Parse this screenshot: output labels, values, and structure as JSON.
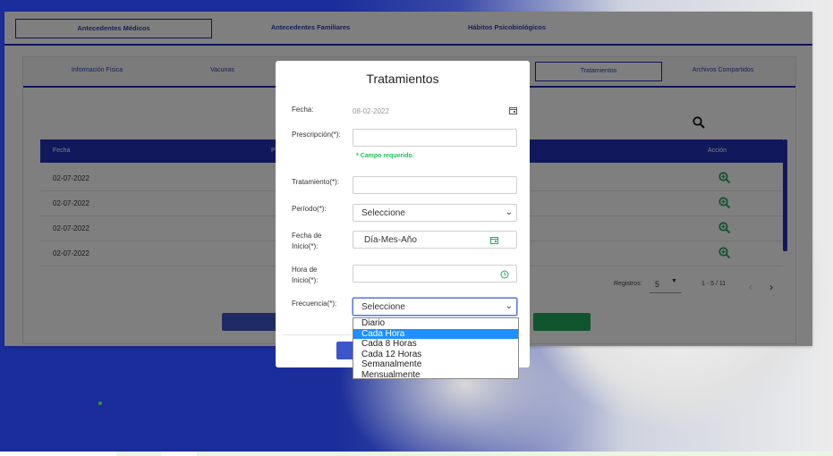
{
  "top_tabs": [
    "Antecedentes Médicos",
    "Antecedentes Familiares",
    "Hábitos Psicobiológicos"
  ],
  "sub_tabs": [
    "Información Física",
    "Vacunas",
    "Tratamientos",
    "Archivos Compartidos"
  ],
  "table": {
    "headers": [
      "Fecha",
      "P",
      "Acción"
    ],
    "rows": [
      "02-07-2022",
      "02-07-2022",
      "02-07-2022",
      "02-07-2022"
    ]
  },
  "footer": {
    "registros_label": "Registros:",
    "registros_value": "5",
    "range": "1 - 5 / 11"
  },
  "modal": {
    "title": "Tratamientos",
    "fecha_label": "Fecha:",
    "fecha_value": "08-02-2022",
    "prescripcion_label": "Prescripción(*):",
    "required_msg": "* Campo requerido.",
    "tratamiento_label": "Tratamiento(*):",
    "periodo_label": "Período(*):",
    "periodo_value": "Seleccione",
    "fecha_inicio_label": "Fecha de Inicio(*):",
    "fecha_inicio_placeholder": "Día-Mes-Año",
    "hora_inicio_label": "Hora de Inicio(*):",
    "frecuencia_label": "Frecuencia(*):",
    "frecuencia_value": "Seleccione"
  },
  "dropdown_options": [
    "Diario",
    "Cada Hora",
    "Cada 8 Horas",
    "Cada 12 Horas",
    "Semanalmente",
    "Mensualmente"
  ],
  "colors": {
    "primary": "#1f2ab8",
    "green": "#1eaa5a",
    "highlight": "#1e90ff"
  }
}
